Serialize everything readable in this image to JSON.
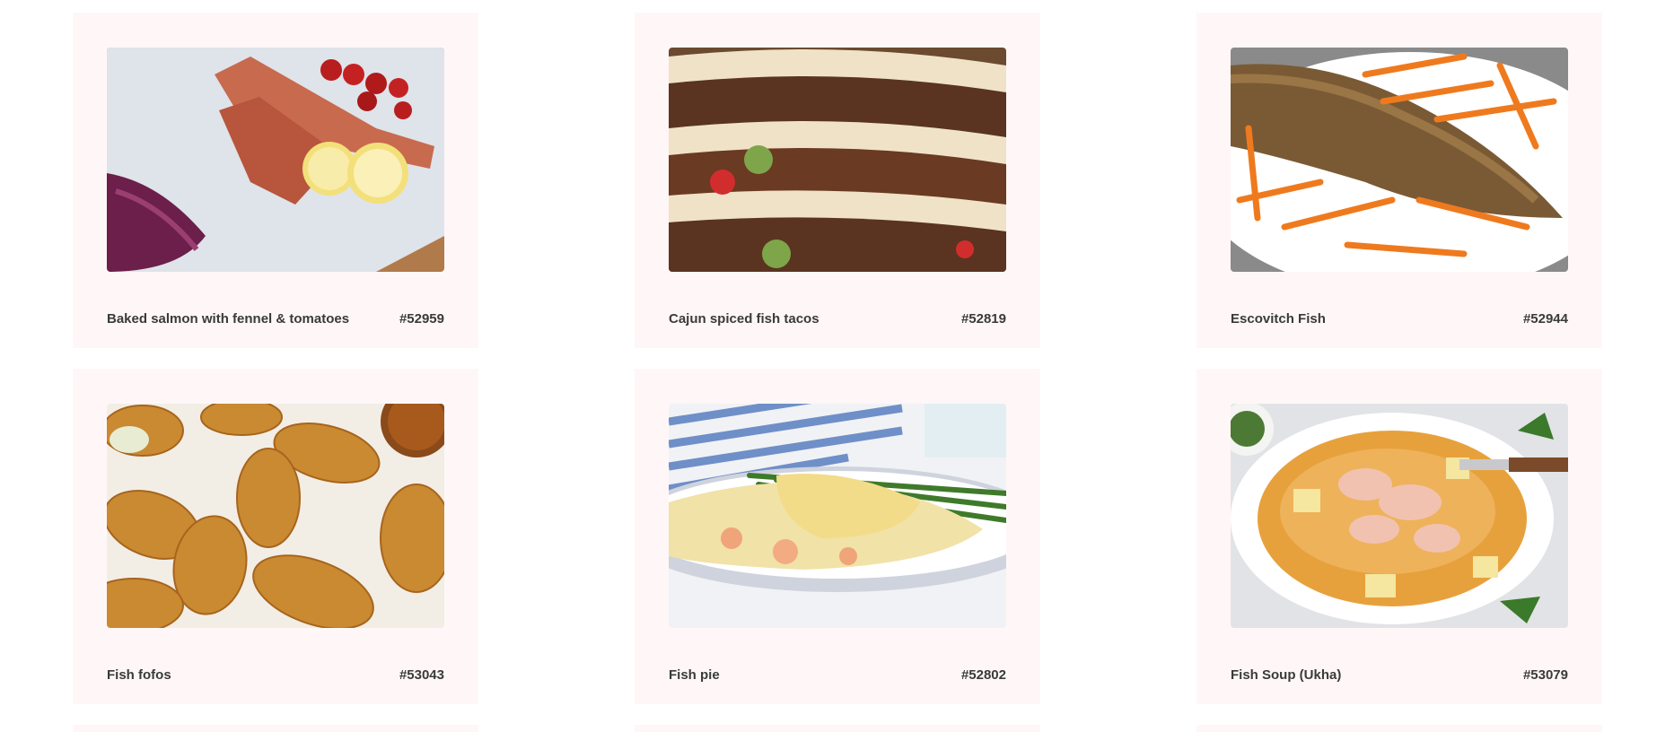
{
  "meals": [
    {
      "name": "Baked salmon with fennel & tomatoes",
      "id": "#52959"
    },
    {
      "name": "Cajun spiced fish tacos",
      "id": "#52819"
    },
    {
      "name": "Escovitch Fish",
      "id": "#52944"
    },
    {
      "name": "Fish fofos",
      "id": "#53043"
    },
    {
      "name": "Fish pie",
      "id": "#52802"
    },
    {
      "name": "Fish Soup (Ukha)",
      "id": "#53079"
    }
  ]
}
